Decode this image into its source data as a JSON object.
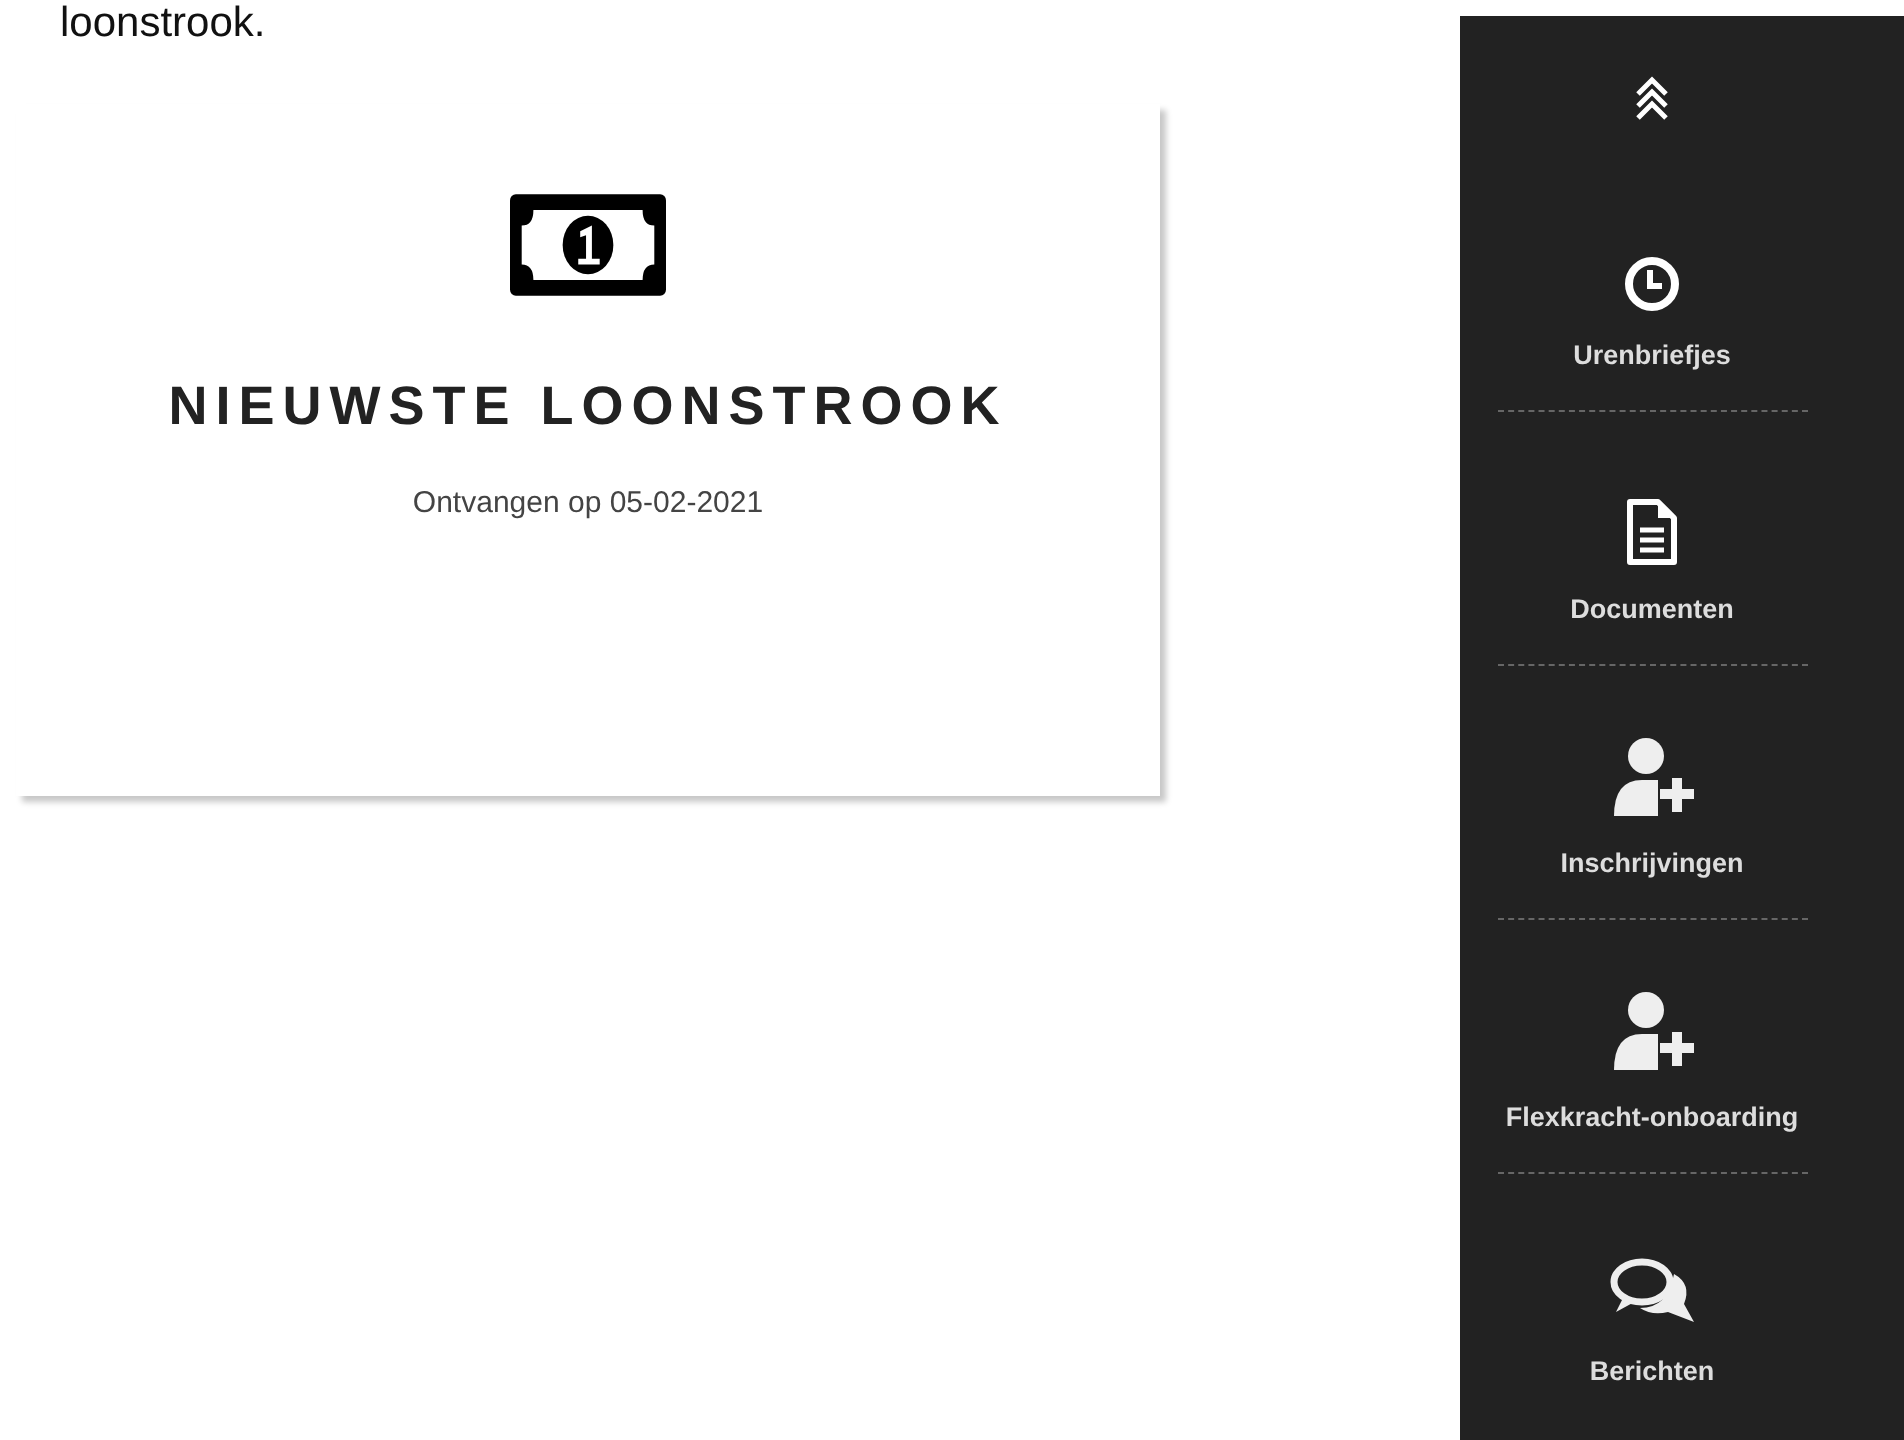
{
  "intro_text": "loonstrook.",
  "payslip_card": {
    "title": "NIEUWSTE LOONSTROOK",
    "subtitle": "Ontvangen op 05-02-2021"
  },
  "sidebar": {
    "items": [
      {
        "kind": "clock",
        "label": "Urenbriefjes"
      },
      {
        "kind": "document",
        "label": "Documenten"
      },
      {
        "kind": "user-plus",
        "label": "Inschrijvingen"
      },
      {
        "kind": "user-plus",
        "label": "Flexkracht-onboarding"
      },
      {
        "kind": "chat",
        "label": "Berichten"
      }
    ]
  }
}
